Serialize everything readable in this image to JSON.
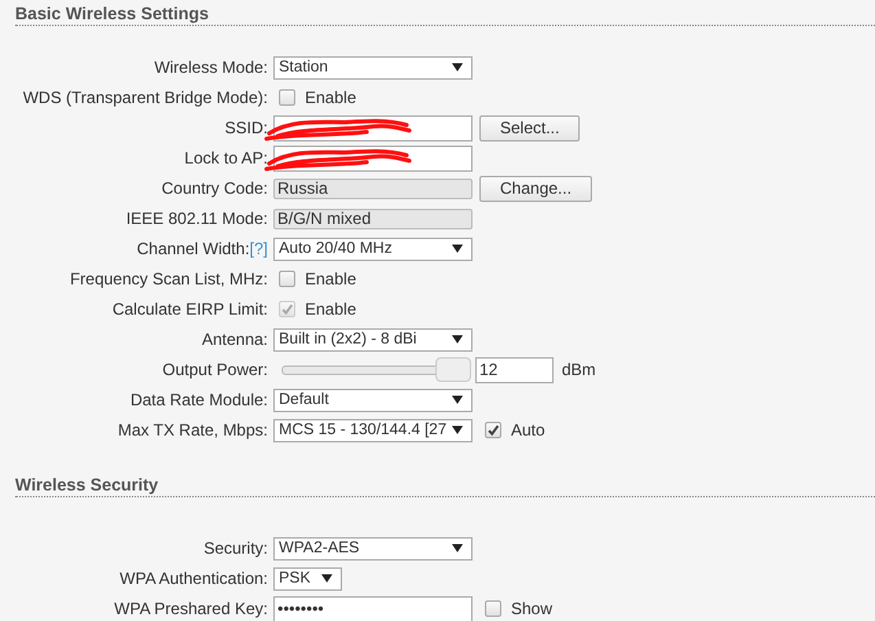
{
  "sections": [
    {
      "title": "Basic Wireless Settings",
      "rows": [
        {
          "kind": "select",
          "label": "Wireless Mode:",
          "value": "Station"
        },
        {
          "kind": "checkbox",
          "label": "WDS (Transparent Bridge Mode):",
          "option": "Enable",
          "checked": false,
          "disabled": false
        },
        {
          "kind": "text",
          "label": "SSID:",
          "button": "Select...",
          "redacted": true
        },
        {
          "kind": "text",
          "label": "Lock to AP:",
          "redacted": true
        },
        {
          "kind": "readonly",
          "label": "Country Code:",
          "value": "Russia",
          "button": "Change..."
        },
        {
          "kind": "readonly",
          "label": "IEEE 802.11 Mode:",
          "value": "B/G/N mixed"
        },
        {
          "kind": "select",
          "label": "Channel Width:",
          "help": "[?]",
          "value": "Auto 20/40 MHz"
        },
        {
          "kind": "checkbox",
          "label": "Frequency Scan List, MHz:",
          "option": "Enable",
          "checked": false,
          "disabled": false
        },
        {
          "kind": "checkbox",
          "label": "Calculate EIRP Limit:",
          "option": "Enable",
          "checked": true,
          "disabled": true
        },
        {
          "kind": "select",
          "label": "Antenna:",
          "value": "Built in (2x2) - 8 dBi"
        },
        {
          "kind": "slider",
          "label": "Output Power:",
          "level": 1,
          "value": "12",
          "unit": "dBm"
        },
        {
          "kind": "select",
          "label": "Data Rate Module:",
          "value": "Default"
        },
        {
          "kind": "select",
          "label": "Max TX Rate, Mbps:",
          "value": "MCS 15 - 130/144.4 [27",
          "option": "Auto",
          "checked": true,
          "disabled": false
        }
      ]
    },
    {
      "title": "Wireless Security",
      "rows": [
        {
          "kind": "select",
          "label": "Security:",
          "value": "WPA2-AES"
        },
        {
          "kind": "short-select",
          "label": "WPA Authentication:",
          "value": "PSK"
        },
        {
          "kind": "text",
          "label": "WPA Preshared Key:",
          "value": "••••••••",
          "option": "Show",
          "checked": false,
          "disabled": false
        }
      ]
    }
  ]
}
